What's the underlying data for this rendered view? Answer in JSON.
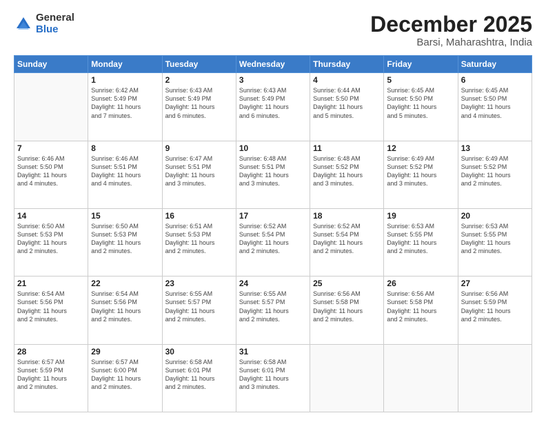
{
  "logo": {
    "general": "General",
    "blue": "Blue"
  },
  "header": {
    "month": "December 2025",
    "location": "Barsi, Maharashtra, India"
  },
  "weekdays": [
    "Sunday",
    "Monday",
    "Tuesday",
    "Wednesday",
    "Thursday",
    "Friday",
    "Saturday"
  ],
  "weeks": [
    [
      {
        "day": "",
        "info": ""
      },
      {
        "day": "1",
        "info": "Sunrise: 6:42 AM\nSunset: 5:49 PM\nDaylight: 11 hours\nand 7 minutes."
      },
      {
        "day": "2",
        "info": "Sunrise: 6:43 AM\nSunset: 5:49 PM\nDaylight: 11 hours\nand 6 minutes."
      },
      {
        "day": "3",
        "info": "Sunrise: 6:43 AM\nSunset: 5:49 PM\nDaylight: 11 hours\nand 6 minutes."
      },
      {
        "day": "4",
        "info": "Sunrise: 6:44 AM\nSunset: 5:50 PM\nDaylight: 11 hours\nand 5 minutes."
      },
      {
        "day": "5",
        "info": "Sunrise: 6:45 AM\nSunset: 5:50 PM\nDaylight: 11 hours\nand 5 minutes."
      },
      {
        "day": "6",
        "info": "Sunrise: 6:45 AM\nSunset: 5:50 PM\nDaylight: 11 hours\nand 4 minutes."
      }
    ],
    [
      {
        "day": "7",
        "info": "Sunrise: 6:46 AM\nSunset: 5:50 PM\nDaylight: 11 hours\nand 4 minutes."
      },
      {
        "day": "8",
        "info": "Sunrise: 6:46 AM\nSunset: 5:51 PM\nDaylight: 11 hours\nand 4 minutes."
      },
      {
        "day": "9",
        "info": "Sunrise: 6:47 AM\nSunset: 5:51 PM\nDaylight: 11 hours\nand 3 minutes."
      },
      {
        "day": "10",
        "info": "Sunrise: 6:48 AM\nSunset: 5:51 PM\nDaylight: 11 hours\nand 3 minutes."
      },
      {
        "day": "11",
        "info": "Sunrise: 6:48 AM\nSunset: 5:52 PM\nDaylight: 11 hours\nand 3 minutes."
      },
      {
        "day": "12",
        "info": "Sunrise: 6:49 AM\nSunset: 5:52 PM\nDaylight: 11 hours\nand 3 minutes."
      },
      {
        "day": "13",
        "info": "Sunrise: 6:49 AM\nSunset: 5:52 PM\nDaylight: 11 hours\nand 2 minutes."
      }
    ],
    [
      {
        "day": "14",
        "info": "Sunrise: 6:50 AM\nSunset: 5:53 PM\nDaylight: 11 hours\nand 2 minutes."
      },
      {
        "day": "15",
        "info": "Sunrise: 6:50 AM\nSunset: 5:53 PM\nDaylight: 11 hours\nand 2 minutes."
      },
      {
        "day": "16",
        "info": "Sunrise: 6:51 AM\nSunset: 5:53 PM\nDaylight: 11 hours\nand 2 minutes."
      },
      {
        "day": "17",
        "info": "Sunrise: 6:52 AM\nSunset: 5:54 PM\nDaylight: 11 hours\nand 2 minutes."
      },
      {
        "day": "18",
        "info": "Sunrise: 6:52 AM\nSunset: 5:54 PM\nDaylight: 11 hours\nand 2 minutes."
      },
      {
        "day": "19",
        "info": "Sunrise: 6:53 AM\nSunset: 5:55 PM\nDaylight: 11 hours\nand 2 minutes."
      },
      {
        "day": "20",
        "info": "Sunrise: 6:53 AM\nSunset: 5:55 PM\nDaylight: 11 hours\nand 2 minutes."
      }
    ],
    [
      {
        "day": "21",
        "info": "Sunrise: 6:54 AM\nSunset: 5:56 PM\nDaylight: 11 hours\nand 2 minutes."
      },
      {
        "day": "22",
        "info": "Sunrise: 6:54 AM\nSunset: 5:56 PM\nDaylight: 11 hours\nand 2 minutes."
      },
      {
        "day": "23",
        "info": "Sunrise: 6:55 AM\nSunset: 5:57 PM\nDaylight: 11 hours\nand 2 minutes."
      },
      {
        "day": "24",
        "info": "Sunrise: 6:55 AM\nSunset: 5:57 PM\nDaylight: 11 hours\nand 2 minutes."
      },
      {
        "day": "25",
        "info": "Sunrise: 6:56 AM\nSunset: 5:58 PM\nDaylight: 11 hours\nand 2 minutes."
      },
      {
        "day": "26",
        "info": "Sunrise: 6:56 AM\nSunset: 5:58 PM\nDaylight: 11 hours\nand 2 minutes."
      },
      {
        "day": "27",
        "info": "Sunrise: 6:56 AM\nSunset: 5:59 PM\nDaylight: 11 hours\nand 2 minutes."
      }
    ],
    [
      {
        "day": "28",
        "info": "Sunrise: 6:57 AM\nSunset: 5:59 PM\nDaylight: 11 hours\nand 2 minutes."
      },
      {
        "day": "29",
        "info": "Sunrise: 6:57 AM\nSunset: 6:00 PM\nDaylight: 11 hours\nand 2 minutes."
      },
      {
        "day": "30",
        "info": "Sunrise: 6:58 AM\nSunset: 6:01 PM\nDaylight: 11 hours\nand 2 minutes."
      },
      {
        "day": "31",
        "info": "Sunrise: 6:58 AM\nSunset: 6:01 PM\nDaylight: 11 hours\nand 3 minutes."
      },
      {
        "day": "",
        "info": ""
      },
      {
        "day": "",
        "info": ""
      },
      {
        "day": "",
        "info": ""
      }
    ]
  ]
}
